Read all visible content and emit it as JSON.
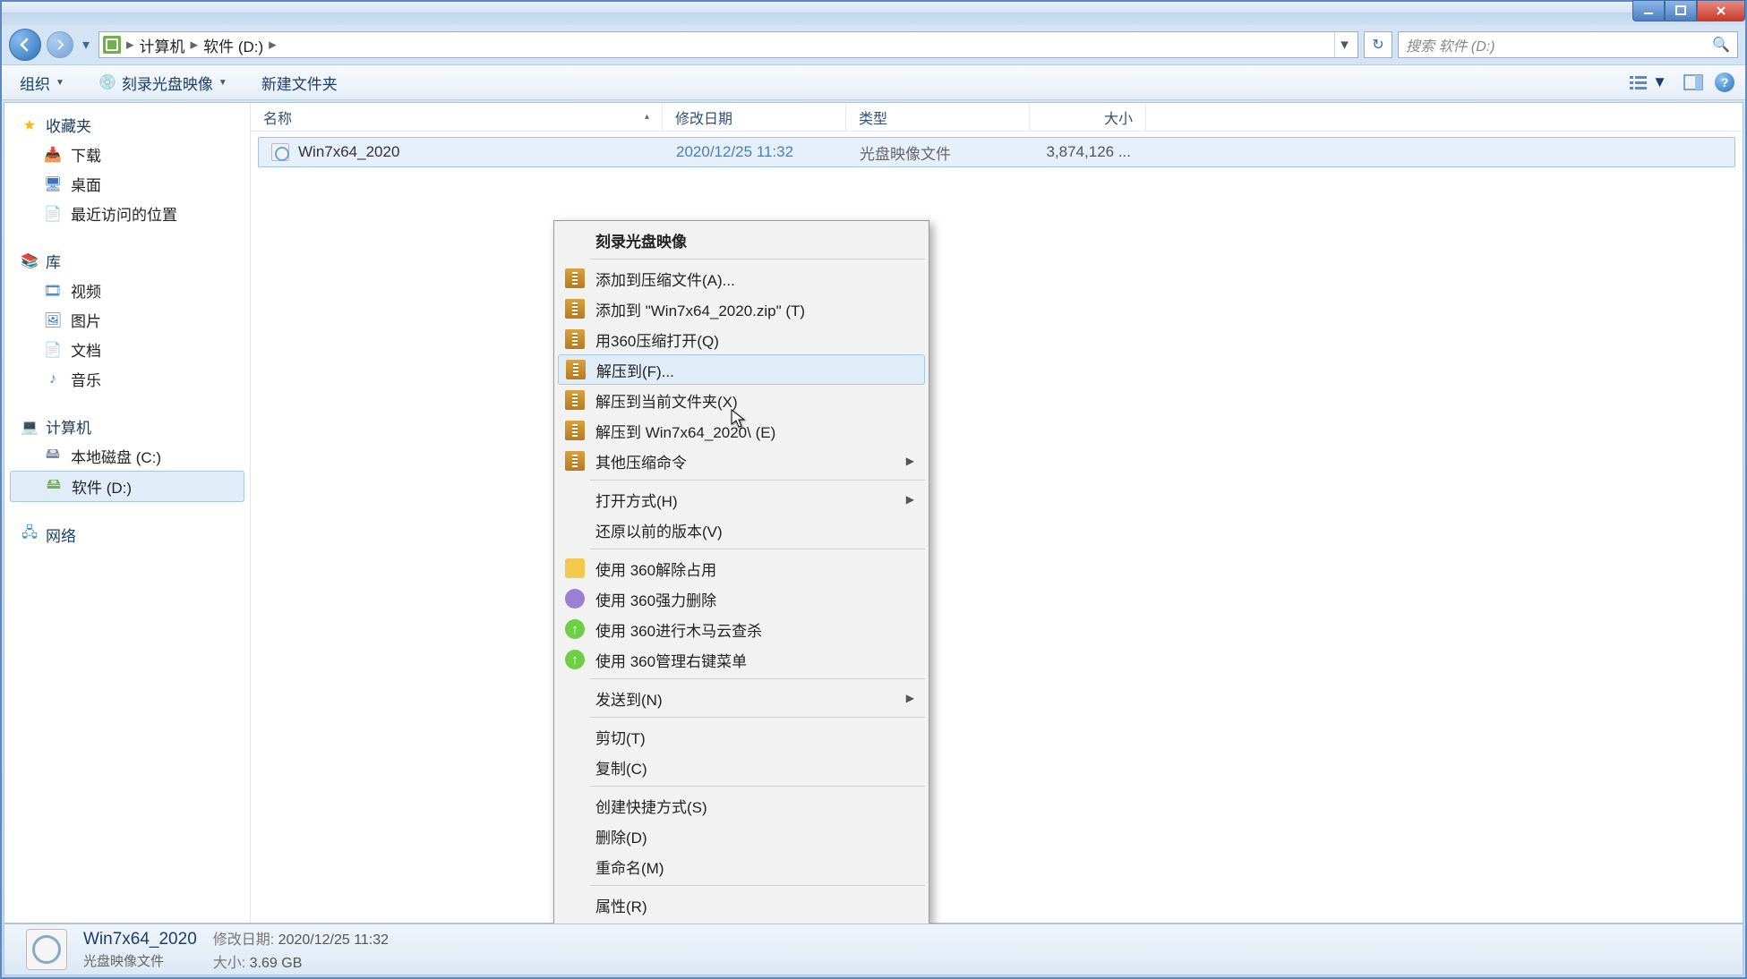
{
  "breadcrumb": {
    "computer": "计算机",
    "drive": "软件 (D:)"
  },
  "search": {
    "placeholder": "搜索 软件 (D:)"
  },
  "toolbar": {
    "organize": "组织",
    "burn": "刻录光盘映像",
    "newfolder": "新建文件夹"
  },
  "columns": {
    "name": "名称",
    "date": "修改日期",
    "type": "类型",
    "size": "大小"
  },
  "sidebar": {
    "favorites": "收藏夹",
    "downloads": "下载",
    "desktop": "桌面",
    "recent": "最近访问的位置",
    "libraries": "库",
    "videos": "视频",
    "pictures": "图片",
    "documents": "文档",
    "music": "音乐",
    "computer": "计算机",
    "localc": "本地磁盘 (C:)",
    "softd": "软件 (D:)",
    "network": "网络"
  },
  "file": {
    "name": "Win7x64_2020",
    "date": "2020/12/25 11:32",
    "type": "光盘映像文件",
    "size": "3,874,126 ..."
  },
  "ctx": {
    "burn": "刻录光盘映像",
    "addarchive": "添加到压缩文件(A)...",
    "addzip": "添加到 \"Win7x64_2020.zip\" (T)",
    "open360": "用360压缩打开(Q)",
    "extractto": "解压到(F)...",
    "extracthere": "解压到当前文件夹(X)",
    "extractfolder": "解压到 Win7x64_2020\\ (E)",
    "othercomp": "其他压缩命令",
    "openwith": "打开方式(H)",
    "restorever": "还原以前的版本(V)",
    "unlock360": "使用 360解除占用",
    "forcedel360": "使用 360强力删除",
    "scan360": "使用 360进行木马云查杀",
    "menu360": "使用 360管理右键菜单",
    "sendto": "发送到(N)",
    "cut": "剪切(T)",
    "copy": "复制(C)",
    "shortcut": "创建快捷方式(S)",
    "delete": "删除(D)",
    "rename": "重命名(M)",
    "properties": "属性(R)"
  },
  "details": {
    "title": "Win7x64_2020",
    "type": "光盘映像文件",
    "modlabel": "修改日期:",
    "modval": "2020/12/25 11:32",
    "sizelabel": "大小:",
    "sizeval": "3.69 GB"
  }
}
